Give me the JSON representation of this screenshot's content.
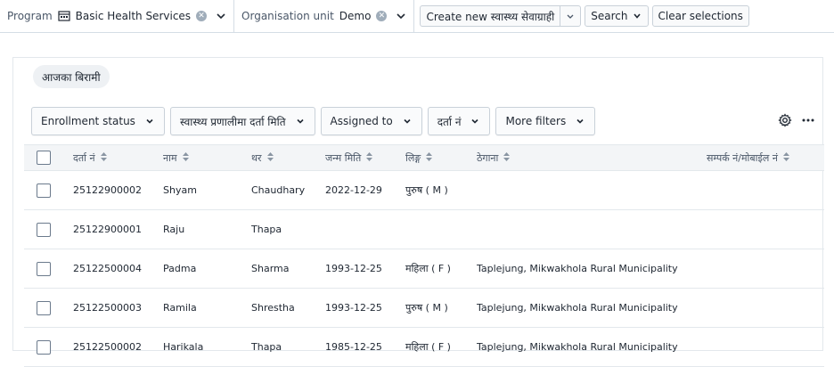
{
  "topbar": {
    "program_label": "Program",
    "program_value": "Basic Health Services",
    "org_label": "Organisation unit",
    "org_value": "Demo",
    "create_new_label": "Create new स्वास्थ्य सेवाग्राही",
    "search_label": "Search",
    "clear_label": "Clear selections"
  },
  "working_list": {
    "chip_label": "आजका बिरामी"
  },
  "filters": [
    {
      "label": "Enrollment status"
    },
    {
      "label": "स्वास्थ्य प्रणालीमा दर्ता मिति"
    },
    {
      "label": "Assigned to"
    },
    {
      "label": "दर्ता नं"
    },
    {
      "label": "More filters"
    }
  ],
  "table": {
    "columns": [
      "दर्ता नं",
      "नाम",
      "थर",
      "जन्म मिति",
      "लिङ्ग",
      "ठेगाना",
      "सम्पर्क नं/मोबाईल नं"
    ],
    "rows": [
      {
        "reg": "25122900002",
        "name": "Shyam",
        "family": "Chaudhary",
        "dob": "2022-12-29",
        "sex": "पुरुष ( M )",
        "address": "",
        "phone": ""
      },
      {
        "reg": "25122900001",
        "name": "Raju",
        "family": "Thapa",
        "dob": "",
        "sex": "",
        "address": "",
        "phone": ""
      },
      {
        "reg": "25122500004",
        "name": "Padma",
        "family": "Sharma",
        "dob": "1993-12-25",
        "sex": "महिला ( F )",
        "address": "Taplejung, Mikwakhola Rural Municipality",
        "phone": ""
      },
      {
        "reg": "25122500003",
        "name": "Ramila",
        "family": "Shrestha",
        "dob": "1993-12-25",
        "sex": "पुरुष ( M )",
        "address": "Taplejung, Mikwakhola Rural Municipality",
        "phone": ""
      },
      {
        "reg": "25122500002",
        "name": "Harikala",
        "family": "Thapa",
        "dob": "1985-12-25",
        "sex": "महिला ( F )",
        "address": "Taplejung, Mikwakhola Rural Municipality",
        "phone": ""
      }
    ]
  }
}
